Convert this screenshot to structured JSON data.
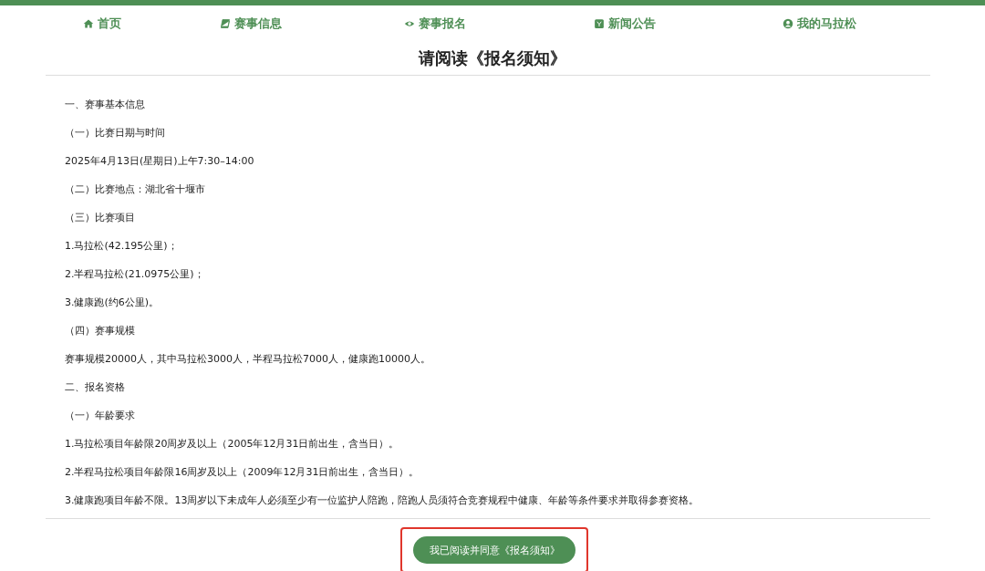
{
  "nav": [
    {
      "label": "首页"
    },
    {
      "label": "赛事信息"
    },
    {
      "label": "赛事报名"
    },
    {
      "label": "新闻公告"
    },
    {
      "label": "我的马拉松"
    }
  ],
  "title": "请阅读《报名须知》",
  "paragraphs": [
    "一、赛事基本信息",
    "（一）比赛日期与时间",
    "2025年4月13日(星期日)上午7:30–14:00",
    "（二）比赛地点：湖北省十堰市",
    "（三）比赛项目",
    "1.马拉松(42.195公里)；",
    "2.半程马拉松(21.0975公里)；",
    "3.健康跑(约6公里)。",
    "（四）赛事规模",
    "赛事规模20000人，其中马拉松3000人，半程马拉松7000人，健康跑10000人。",
    "二、报名资格",
    "（一）年龄要求",
    "1.马拉松项目年龄限20周岁及以上（2005年12月31日前出生，含当日）。",
    "2.半程马拉松项目年龄限16周岁及以上（2009年12月31日前出生，含当日）。",
    "3.健康跑项目年龄不限。13周岁以下未成年人必须至少有一位监护人陪跑，陪跑人员须符合竞赛规程中健康、年龄等条件要求并取得参赛资格。"
  ],
  "agree_button": {
    "label": "我已阅读并同意《报名须知》",
    "highlighted": true
  }
}
